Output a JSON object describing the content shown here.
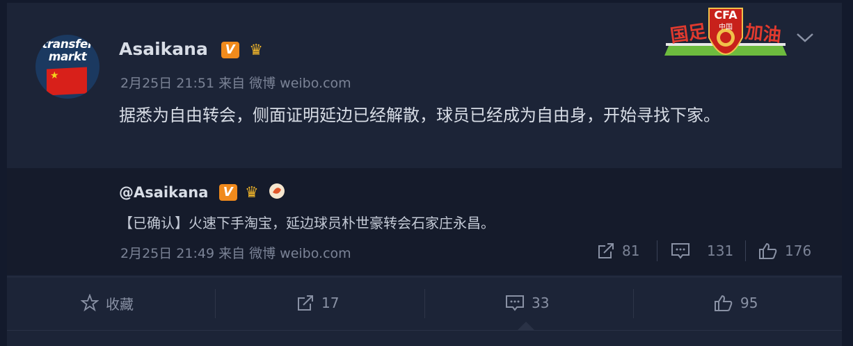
{
  "post": {
    "username": "Asaikana",
    "verified_badge": "V",
    "time": "2月25日 21:51 来自 微博 weibo.com",
    "text": "据悉为自由转会，侧面证明延边已经解散，球员已经成为自由身，开始寻找下家。",
    "avatar_logo_line1": "transfer",
    "avatar_logo_line2": "markt"
  },
  "emblem": {
    "left_text": "国足",
    "center_text": "CFA",
    "right_text": "加油",
    "sub_text": "中国"
  },
  "repost": {
    "username": "@Asaikana",
    "verified_badge": "V",
    "text": "【已确认】火速下手淘宝，延边球员朴世豪转会石家庄永昌。",
    "time": "2月25日 21:49 来自 微博 weibo.com",
    "forward_count": "81",
    "comment_count": "131",
    "like_count": "176"
  },
  "actions": {
    "favorite_label": "收藏",
    "forward_count": "17",
    "comment_count": "33",
    "like_count": "95"
  },
  "colors": {
    "background": "#131a2c",
    "card": "#1c2437",
    "repost_bg": "#151b2b",
    "text": "#d8dde6",
    "muted": "#7b8396",
    "vbadge": "#f08a1c",
    "crown": "#f0b52a"
  }
}
